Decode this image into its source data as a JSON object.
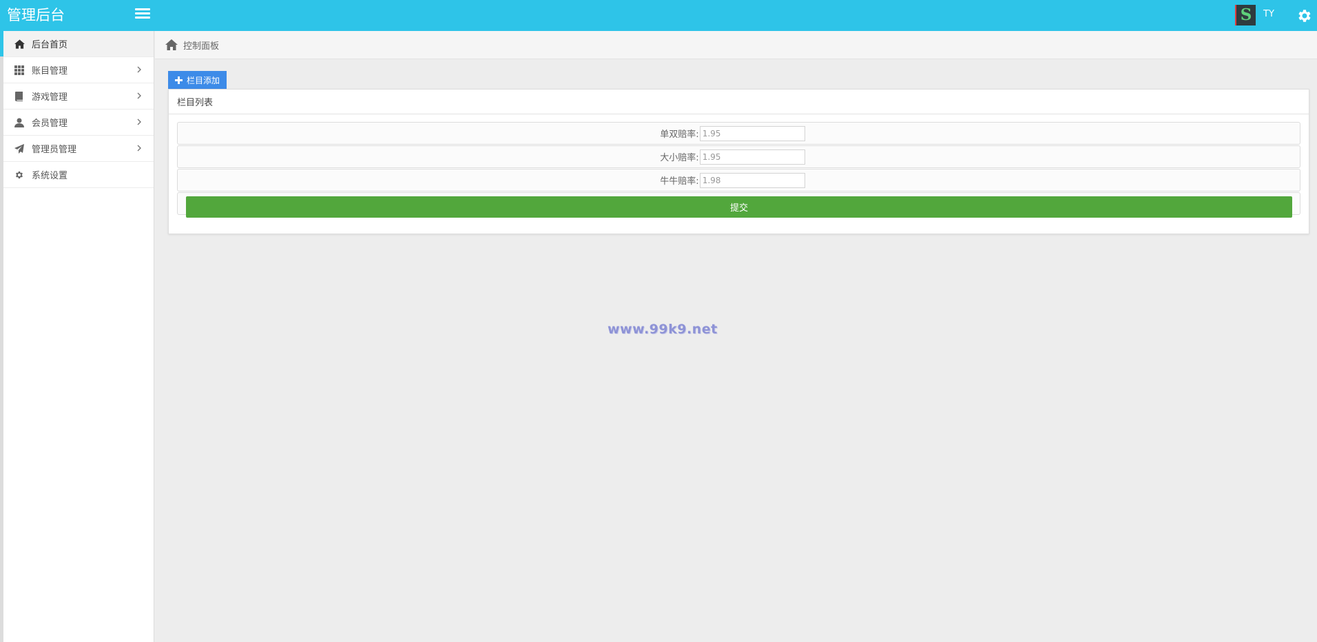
{
  "header": {
    "brand": "管理后台",
    "menu_toggle_icon": "hamburger-icon",
    "avatar_letter": "S",
    "username": "TY",
    "settings_icon": "gear-icon",
    "colors": {
      "navbar": "#2ec4e8"
    }
  },
  "sidebar": {
    "items": [
      {
        "label": "后台首页",
        "icon": "home-icon",
        "has_arrow": false,
        "active": true
      },
      {
        "label": "账目管理",
        "icon": "grid-icon",
        "has_arrow": true,
        "active": false
      },
      {
        "label": "游戏管理",
        "icon": "book-icon",
        "has_arrow": true,
        "active": false
      },
      {
        "label": "会员管理",
        "icon": "user-icon",
        "has_arrow": true,
        "active": false
      },
      {
        "label": "管理员管理",
        "icon": "send-icon",
        "has_arrow": true,
        "active": false
      },
      {
        "label": "系统设置",
        "icon": "cog-icon",
        "has_arrow": false,
        "active": false
      }
    ]
  },
  "breadcrumb": {
    "icon": "home-icon",
    "label": "控制面板"
  },
  "main": {
    "add_button": {
      "label": "栏目添加",
      "icon": "plus-icon"
    },
    "panel": {
      "title": "栏目列表",
      "fields": [
        {
          "label": "单双赔率:",
          "value": "1.95"
        },
        {
          "label": "大小赔率:",
          "value": "1.95"
        },
        {
          "label": "牛牛赔率:",
          "value": "1.98"
        }
      ],
      "submit_label": "提交",
      "colors": {
        "submit": "#52a73c",
        "add": "#3d8be8"
      }
    }
  },
  "watermark": "www.99k9.net"
}
